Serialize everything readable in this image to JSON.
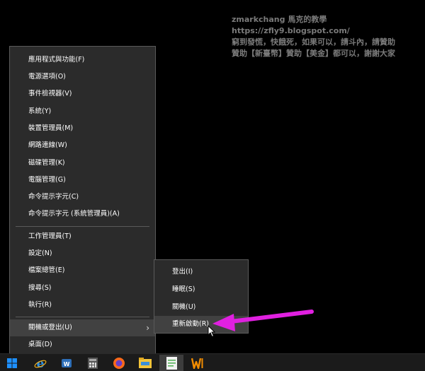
{
  "watermark": {
    "line1": "zmarkchang 馬克的教學",
    "line2": "https://zfly9.blogspot.com/",
    "line3": "窮到發慌，快餓死，如果可以，請斗內，請贊助",
    "line4": "贊助【新臺幣】贊助【美金】都可以，謝謝大家"
  },
  "menu": {
    "group1": [
      "應用程式與功能(F)",
      "電源選項(O)",
      "事件檢視器(V)",
      "系統(Y)",
      "裝置管理員(M)",
      "網路連線(W)",
      "磁碟管理(K)",
      "電腦管理(G)",
      "命令提示字元(C)",
      "命令提示字元 (系統管理員)(A)"
    ],
    "group2": [
      "工作管理員(T)",
      "設定(N)",
      "檔案總管(E)",
      "搜尋(S)",
      "執行(R)"
    ],
    "shutdown": "關機或登出(U)",
    "desktop": "桌面(D)"
  },
  "submenu": [
    "登出(I)",
    "睡眠(S)",
    "關機(U)",
    "重新啟動(R)"
  ],
  "colors": {
    "arrow": "#e020e0",
    "menu_bg": "#2b2b2b",
    "highlight": "#414141"
  },
  "taskbar": {
    "icons": [
      "windows-start-icon",
      "internet-explorer-icon",
      "app-icon",
      "calculator-icon",
      "firefox-icon",
      "file-explorer-icon",
      "notepad-icon",
      "winamp-icon"
    ]
  }
}
